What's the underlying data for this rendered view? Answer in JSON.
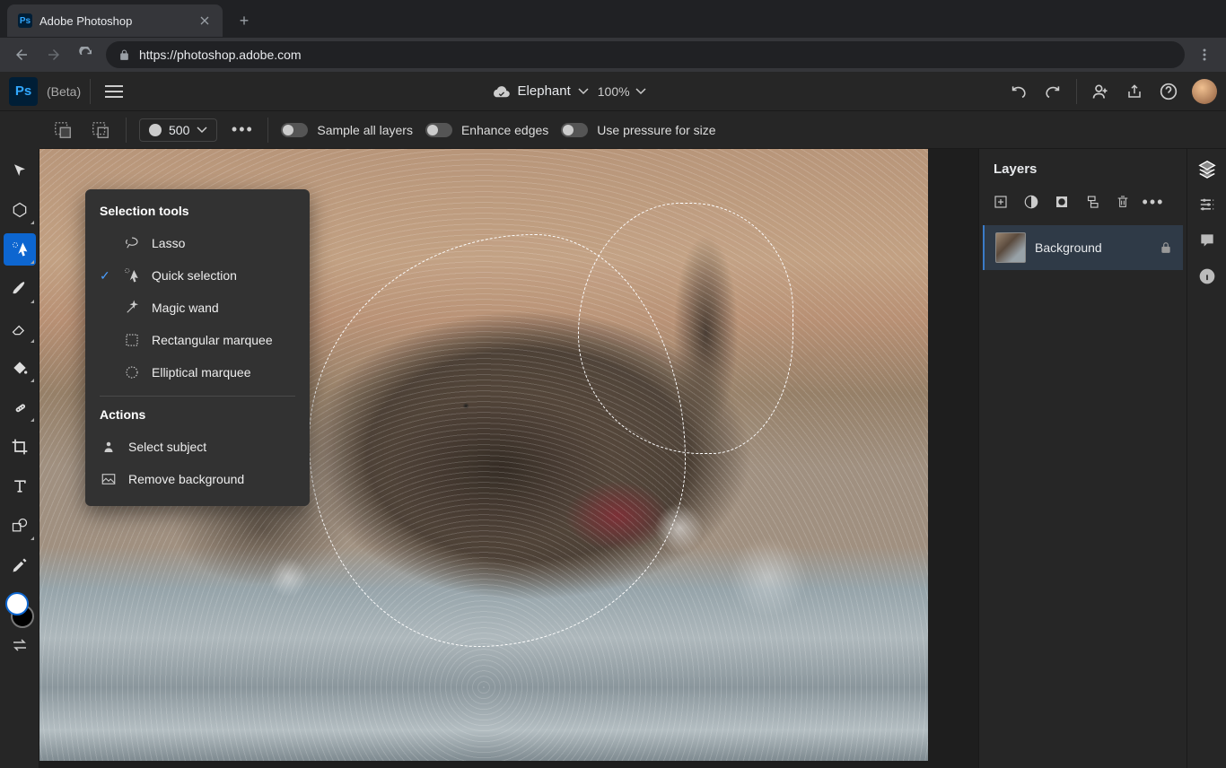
{
  "browser": {
    "tab_title": "Adobe Photoshop",
    "url": "https://photoshop.adobe.com"
  },
  "header": {
    "beta_label": "(Beta)",
    "doc_name": "Elephant",
    "zoom": "100%"
  },
  "options_bar": {
    "brush_size": "500",
    "sample_all_layers": "Sample all layers",
    "enhance_edges": "Enhance edges",
    "use_pressure": "Use pressure for size"
  },
  "tool_flyout": {
    "section1_title": "Selection tools",
    "items": [
      {
        "label": "Lasso",
        "icon": "lasso",
        "checked": false
      },
      {
        "label": "Quick selection",
        "icon": "quick-select",
        "checked": true
      },
      {
        "label": "Magic wand",
        "icon": "magic-wand",
        "checked": false
      },
      {
        "label": "Rectangular marquee",
        "icon": "rect-marquee",
        "checked": false
      },
      {
        "label": "Elliptical marquee",
        "icon": "ellipse-marquee",
        "checked": false
      }
    ],
    "section2_title": "Actions",
    "actions": [
      {
        "label": "Select subject",
        "icon": "select-subject"
      },
      {
        "label": "Remove background",
        "icon": "remove-bg"
      }
    ]
  },
  "layers_panel": {
    "title": "Layers",
    "layer_name": "Background"
  },
  "colors": {
    "foreground": "#ffffff",
    "background": "#000000",
    "accent": "#0d66d0"
  }
}
